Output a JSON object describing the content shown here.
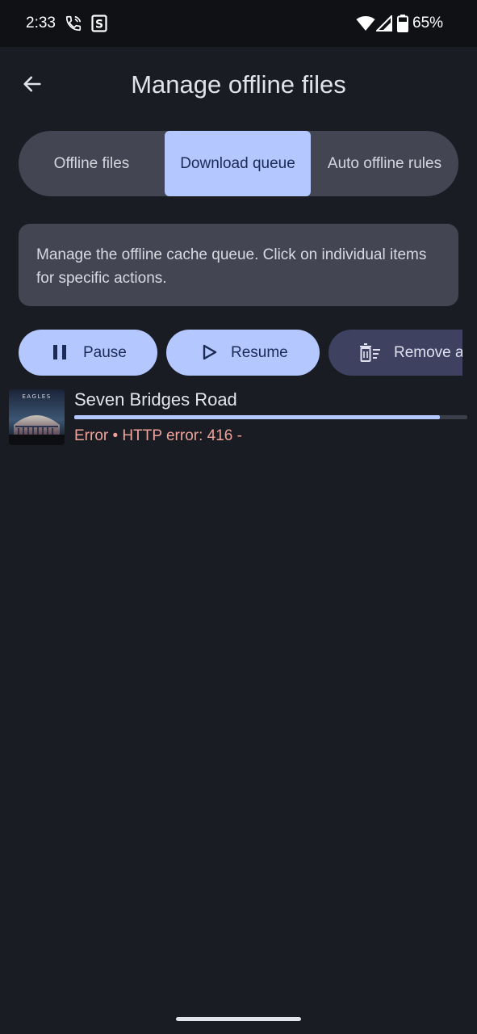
{
  "status_bar": {
    "time": "2:33",
    "battery": "65%",
    "icons": [
      "call-forward-icon",
      "s-notification-icon",
      "wifi-icon",
      "signal-icon",
      "battery-icon"
    ]
  },
  "app_bar": {
    "title": "Manage offline files",
    "back_icon": "arrow-left-icon"
  },
  "tabs": [
    {
      "label": "Offline files",
      "selected": false
    },
    {
      "label": "Download queue",
      "selected": true
    },
    {
      "label": "Auto offline rules",
      "selected": false
    }
  ],
  "info": {
    "text": "Manage the offline cache queue. Click on individual items for specific actions."
  },
  "actions": {
    "pause": "Pause",
    "resume": "Resume",
    "remove": "Remove a"
  },
  "queue": [
    {
      "title": "Seven Bridges Road",
      "status": "Error • HTTP error: 416 -",
      "progress": 0.93,
      "album_art_text": "EAGLES"
    }
  ],
  "colors": {
    "background": "#191c23",
    "surface": "#434652",
    "accent": "#b4c7ff",
    "error": "#f0a39a"
  }
}
